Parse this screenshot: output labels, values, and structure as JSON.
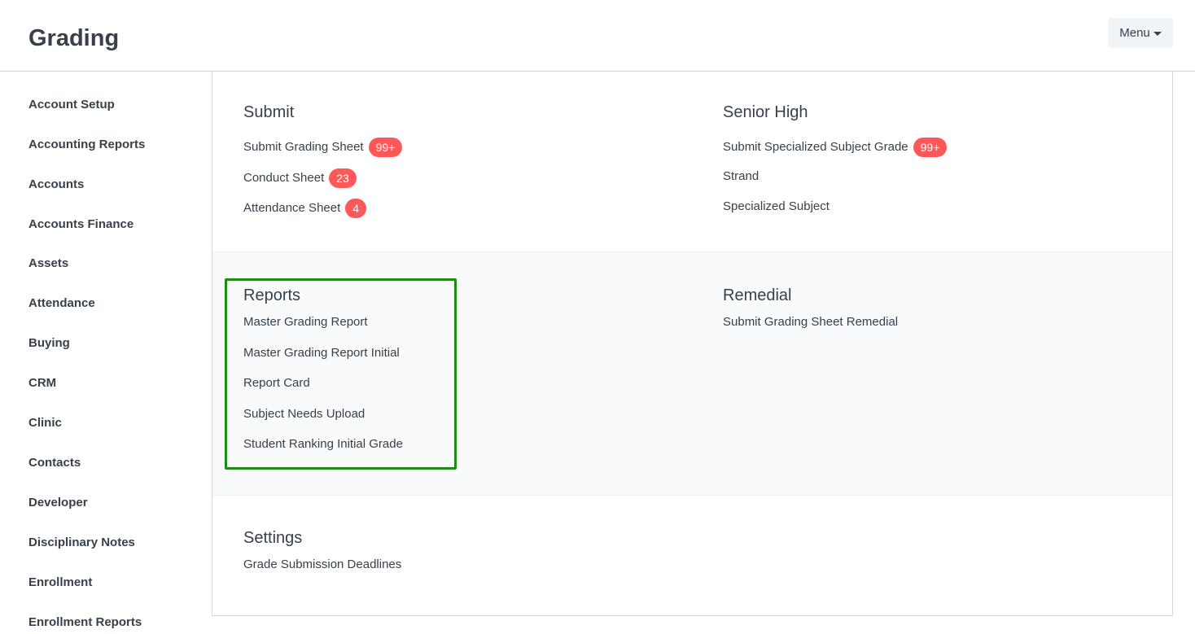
{
  "header": {
    "title": "Grading",
    "menu_label": "Menu"
  },
  "sidebar": {
    "items": [
      {
        "label": "Account Setup"
      },
      {
        "label": "Accounting Reports"
      },
      {
        "label": "Accounts"
      },
      {
        "label": "Accounts Finance"
      },
      {
        "label": "Assets"
      },
      {
        "label": "Attendance"
      },
      {
        "label": "Buying"
      },
      {
        "label": "CRM"
      },
      {
        "label": "Clinic"
      },
      {
        "label": "Contacts"
      },
      {
        "label": "Developer"
      },
      {
        "label": "Disciplinary Notes"
      },
      {
        "label": "Enrollment"
      },
      {
        "label": "Enrollment Reports"
      }
    ]
  },
  "sections": {
    "submit": {
      "title": "Submit",
      "links": [
        {
          "label": "Submit Grading Sheet",
          "badge": "99+"
        },
        {
          "label": "Conduct Sheet",
          "badge": "23"
        },
        {
          "label": "Attendance Sheet",
          "badge": "4"
        }
      ]
    },
    "senior_high": {
      "title": "Senior High",
      "links": [
        {
          "label": "Submit Specialized Subject Grade",
          "badge": "99+"
        },
        {
          "label": "Strand"
        },
        {
          "label": "Specialized Subject"
        }
      ]
    },
    "reports": {
      "title": "Reports",
      "links": [
        {
          "label": "Master Grading Report"
        },
        {
          "label": "Master Grading Report Initial"
        },
        {
          "label": "Report Card"
        },
        {
          "label": "Subject Needs Upload"
        },
        {
          "label": "Student Ranking Initial Grade"
        }
      ]
    },
    "remedial": {
      "title": "Remedial",
      "links": [
        {
          "label": "Submit Grading Sheet Remedial"
        }
      ]
    },
    "settings": {
      "title": "Settings",
      "links": [
        {
          "label": "Grade Submission Deadlines"
        }
      ]
    }
  },
  "colors": {
    "badge": "#ff5858",
    "highlight": "#1e8a12",
    "text": "#36414c"
  }
}
